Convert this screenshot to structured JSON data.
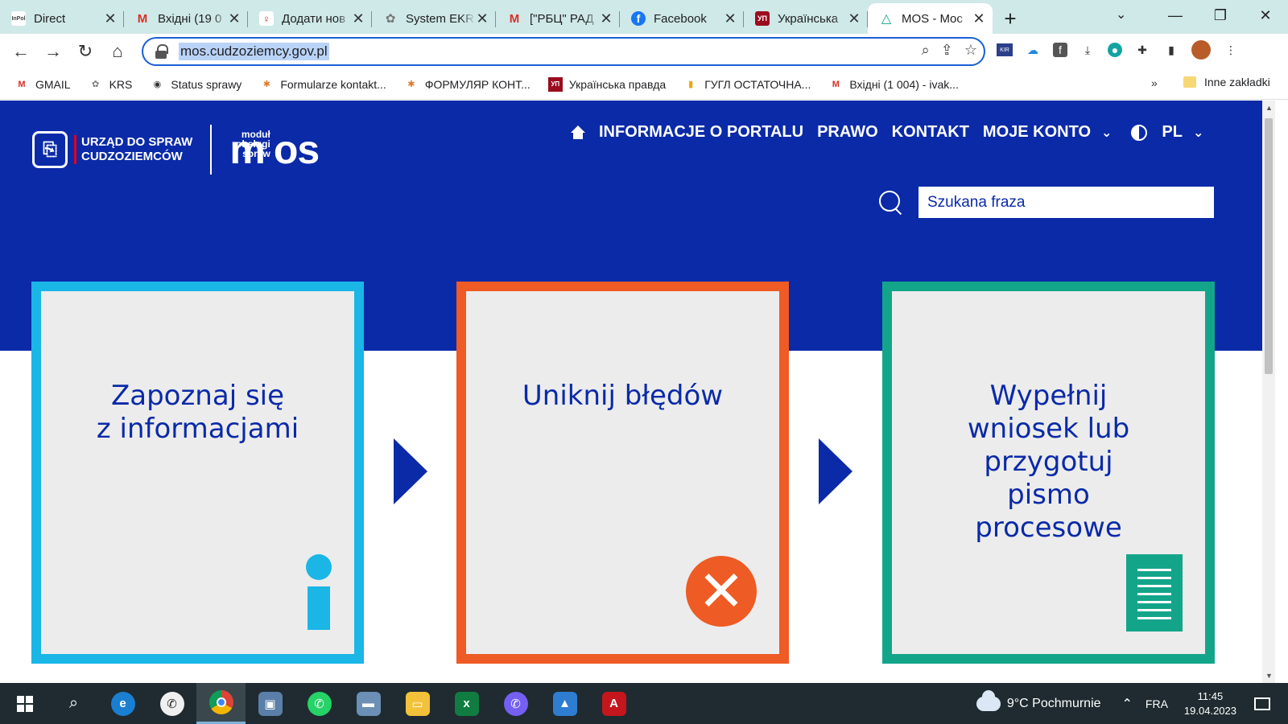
{
  "browser": {
    "tabs": [
      {
        "title": "Direct",
        "favicon": "InPol",
        "color": "#ffffff",
        "text": "#444444"
      },
      {
        "title": "Вхідні (19 0",
        "favicon": "M",
        "color": "#ffffff",
        "text": "#d93025"
      },
      {
        "title": "Додати нов",
        "favicon": "♀",
        "color": "#ffffff",
        "text": "#d93025"
      },
      {
        "title": "System EKR",
        "favicon": "✿",
        "color": "#cfe8e8",
        "text": "#777777"
      },
      {
        "title": "[\"РБЦ\" РАД",
        "favicon": "M",
        "color": "#ffffff",
        "text": "#d93025"
      },
      {
        "title": "Facebook",
        "favicon": "f",
        "color": "#1877f2",
        "text": "#ffffff"
      },
      {
        "title": "Українська",
        "favicon": "УП",
        "color": "#9b0b1e",
        "text": "#ffffff"
      },
      {
        "title": "MOS - Moc",
        "favicon": "△",
        "color": "#ffffff",
        "text": "#13a58a",
        "active": true
      }
    ],
    "new_tab": "+",
    "url": "mos.cudzoziemcy.gov.pl",
    "bookmarks": [
      {
        "label": "GMAIL",
        "icon": "M",
        "color": "#d93025"
      },
      {
        "label": "KRS",
        "icon": "✿",
        "color": "#777777"
      },
      {
        "label": "Status sprawy",
        "icon": "◉",
        "color": "#333333"
      },
      {
        "label": "Formularze kontakt...",
        "icon": "✱",
        "color": "#e07a2f"
      },
      {
        "label": "ФОРМУЛЯР КОНТ...",
        "icon": "✱",
        "color": "#e07a2f"
      },
      {
        "label": "Українська правда",
        "icon": "УП",
        "color": "#9b0b1e"
      },
      {
        "label": "ГУГЛ ОСТАТОЧНА...",
        "icon": "▮",
        "color": "#f4a400"
      },
      {
        "label": "Вхідні (1 004) - ivak...",
        "icon": "M",
        "color": "#d93025"
      }
    ],
    "bookmarks_more": "»",
    "other_bookmarks": "Inne zakładki"
  },
  "site": {
    "logo_line1": "URZĄD DO SPRAW",
    "logo_line2": "CUDZOZIEMCÓW",
    "mos_small1": "moduł",
    "mos_small2": "obsługi",
    "mos_small3": "spraw",
    "mos_m": "m",
    "mos_os": "os",
    "nav": {
      "info": "INFORMACJE O PORTALU",
      "law": "PRAWO",
      "contact": "KONTAKT",
      "account": "MOJE KONTO",
      "lang": "PL"
    },
    "search_placeholder": "Szukana fraza",
    "cards": [
      {
        "title": "Zapoznaj się\nz informacjami",
        "border": "#1ab6e6"
      },
      {
        "title": "Uniknij błędów",
        "border": "#ee5b24"
      },
      {
        "title": "Wypełnij\nwniosek lub\nprzygotuj\npismo\nprocesowe",
        "border": "#13a58a"
      }
    ],
    "brand_color": "#0a2aa8"
  },
  "taskbar": {
    "weather": "9°C  Pochmurnie",
    "lang": "FRA",
    "time": "11:45",
    "date": "19.04.2023"
  }
}
